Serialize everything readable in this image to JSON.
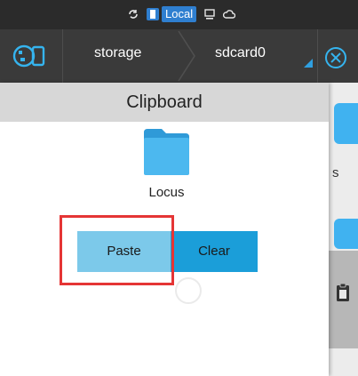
{
  "status_bar": {
    "location_label": "Local"
  },
  "toolbar": {
    "breadcrumb": [
      "storage",
      "sdcard0"
    ]
  },
  "dialog": {
    "title": "Clipboard",
    "item": {
      "name": "Locus",
      "icon": "folder-icon"
    },
    "buttons": {
      "paste": "Paste",
      "clear": "Clear"
    }
  },
  "background": {
    "partial_label": "s"
  },
  "colors": {
    "accent": "#35b4ef",
    "folder": "#40b2f0",
    "paste_button": "#7cc9ea",
    "clear_button": "#1b9ed9",
    "highlight": "#e53535",
    "toolbar": "#3a3a3a"
  }
}
